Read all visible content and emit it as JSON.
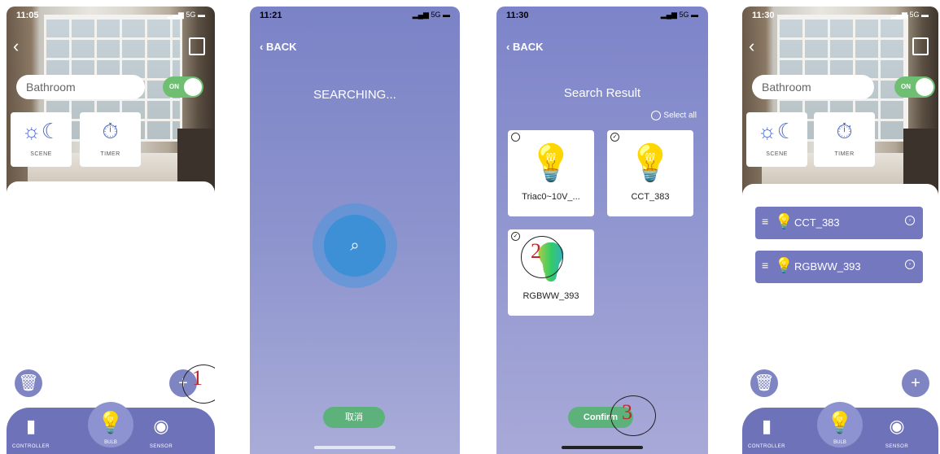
{
  "screens": [
    {
      "time": "11:05",
      "signal": "5G",
      "room_name": "Bathroom",
      "toggle_label": "ON",
      "tiles": [
        {
          "label": "SCENE",
          "icon": "sun-moon-icon"
        },
        {
          "label": "TIMER",
          "icon": "stopwatch-icon"
        }
      ],
      "nav": [
        {
          "label": "CONTROLLER"
        },
        {
          "label": "BULB"
        },
        {
          "label": "SENSOR"
        }
      ],
      "annotation": "1"
    },
    {
      "time": "11:21",
      "signal": "5G",
      "back_label": "BACK",
      "status": "SEARCHING...",
      "cancel_label": "取消"
    },
    {
      "time": "11:30",
      "signal": "5G",
      "back_label": "BACK",
      "title": "Search Result",
      "select_all": "Select all",
      "devices": [
        {
          "name": "Triac0~10V_...",
          "checked": false
        },
        {
          "name": "CCT_383",
          "checked": true
        },
        {
          "name": "RGBWW_393",
          "checked": true
        }
      ],
      "confirm_label": "Confirm",
      "annotations": [
        "2",
        "3"
      ]
    },
    {
      "time": "11:30",
      "signal": "5G",
      "room_name": "Bathroom",
      "toggle_label": "ON",
      "tiles": [
        {
          "label": "SCENE",
          "icon": "sun-moon-icon"
        },
        {
          "label": "TIMER",
          "icon": "stopwatch-icon"
        }
      ],
      "devices": [
        {
          "name": "CCT_383"
        },
        {
          "name": "RGBWW_393"
        }
      ],
      "nav": [
        {
          "label": "CONTROLLER"
        },
        {
          "label": "BULB"
        },
        {
          "label": "SENSOR"
        }
      ]
    }
  ],
  "colors": {
    "primary": "#6e73b9",
    "accent_blue": "#3f6ad8",
    "green": "#5cb27a",
    "annotation_red": "#c0282a"
  }
}
